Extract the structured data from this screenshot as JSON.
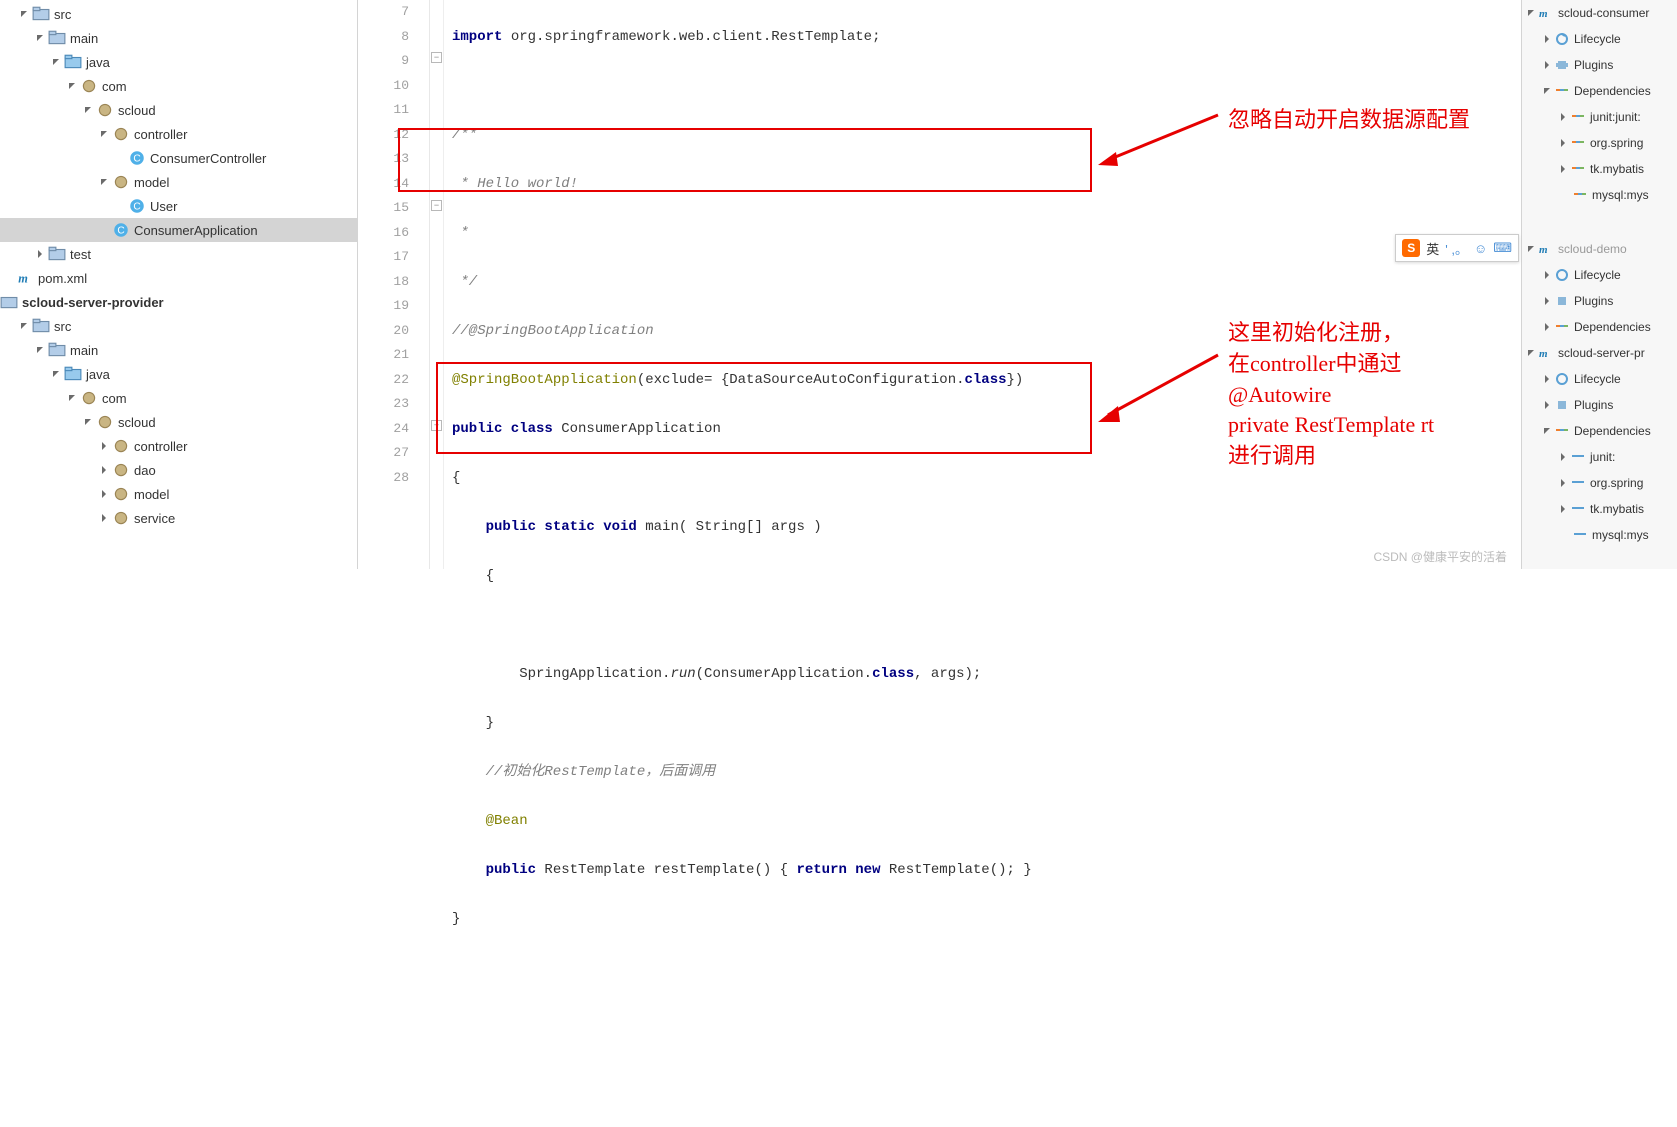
{
  "tree": {
    "src1": "src",
    "main1": "main",
    "java1": "java",
    "com1": "com",
    "scloud1": "scloud",
    "controller1": "controller",
    "consumerController": "ConsumerController",
    "model1": "model",
    "user": "User",
    "consumerApp": "ConsumerApplication",
    "test": "test",
    "pom": "pom.xml",
    "provider": "scloud-server-provider",
    "src2": "src",
    "main2": "main",
    "java2": "java",
    "com2": "com",
    "scloud2": "scloud",
    "controller2": "controller",
    "dao": "dao",
    "model2": "model",
    "service": "service"
  },
  "gutter": [
    "7",
    "8",
    "9",
    "10",
    "11",
    "12",
    "13",
    "14",
    "15",
    "16",
    "17",
    "18",
    "19",
    "20",
    "21",
    "22",
    "23",
    "24",
    "27",
    "28"
  ],
  "code": {
    "l7a": "import ",
    "l7b": "org.springframework.web.client.RestTemplate;",
    "l8": "",
    "l9": "/**",
    "l10": " * Hello world!",
    "l11": " *",
    "l12": " */",
    "l13": "//@SpringBootApplication",
    "l14a": "@SpringBootApplication",
    "l14b": "(exclude= {DataSourceAutoConfiguration.",
    "l14c": "class",
    "l14d": "})",
    "l15a": "public class ",
    "l15b": "ConsumerApplication",
    "l16": "{",
    "l17a": "    public static void ",
    "l17b": "main( String[] args )",
    "l18": "    {",
    "l19": "",
    "l20a": "        SpringApplication.",
    "l20b": "run",
    "l20c": "(ConsumerApplication.",
    "l20d": "class",
    "l20e": ", args);",
    "l21": "    }",
    "l22": "    //初始化RestTemplate，后面调用",
    "l23": "    @Bean",
    "l24a": "    public ",
    "l24b": "RestTemplate restTemplate() { ",
    "l24c": "return new ",
    "l24d": "RestTemplate(); }",
    "l27": "}",
    "l28": ""
  },
  "annotations": {
    "a1": "忽略自动开启数据源配置",
    "a2": "这里初始化注册，\n在controller中通过\n@Autowire\nprivate RestTemplate rt\n进行调用"
  },
  "right": {
    "consumer": "scloud-consumer",
    "lifecycle": "Lifecycle",
    "plugins": "Plugins",
    "deps": "Dependencies",
    "junit": "junit:junit:",
    "orgspring": "org.spring",
    "tkmybatis": "tk.mybatis",
    "mysql": "mysql:mys",
    "demo": "scloud-demo",
    "lifecycle2": "Lifecycle",
    "plugins2": "Plugins",
    "deps2": "Dependencies",
    "serverpr": "scloud-server-pr",
    "lifecycle3": "Lifecycle",
    "plugins3": "Plugins",
    "deps3": "Dependencies",
    "junit3": "junit:",
    "orgspring3": "org.spring",
    "tkmybatis3": "tk.mybatis",
    "mysql3": "mysql:mys"
  },
  "ime": {
    "label": "英",
    "punct": "' ,。"
  },
  "watermark": "CSDN @健康平安的活着"
}
